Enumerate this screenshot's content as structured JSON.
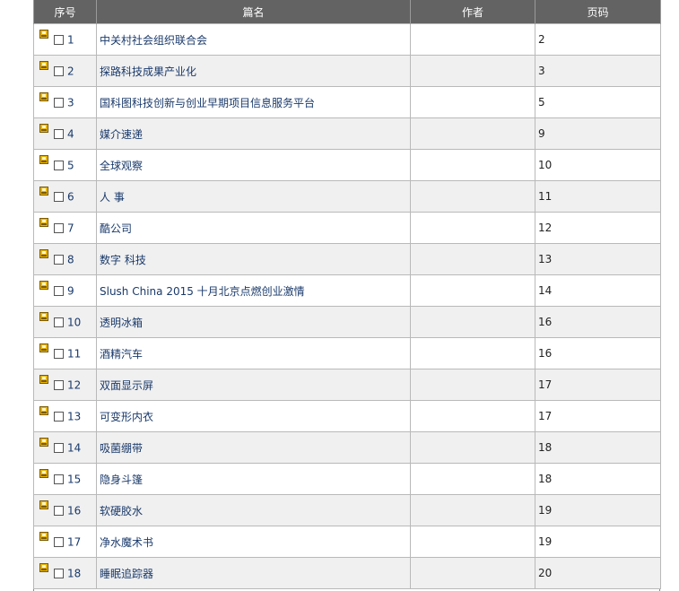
{
  "header": {
    "col_no": "序号",
    "col_title": "篇名",
    "col_author": "作者",
    "col_page": "页码"
  },
  "rows": [
    {
      "no": "1",
      "title": "中关村社会组织联合会",
      "author": "",
      "page": "2"
    },
    {
      "no": "2",
      "title": "探路科技成果产业化",
      "author": "",
      "page": "3"
    },
    {
      "no": "3",
      "title": "国科图科技创新与创业早期项目信息服务平台",
      "author": "",
      "page": "5"
    },
    {
      "no": "4",
      "title": "媒介速递",
      "author": "",
      "page": "9"
    },
    {
      "no": "5",
      "title": "全球观察",
      "author": "",
      "page": "10"
    },
    {
      "no": "6",
      "title": "人 事",
      "author": "",
      "page": "11"
    },
    {
      "no": "7",
      "title": "酷公司",
      "author": "",
      "page": "12"
    },
    {
      "no": "8",
      "title": "数字 科技",
      "author": "",
      "page": "13"
    },
    {
      "no": "9",
      "title": "Slush China 2015 十月北京点燃创业激情",
      "author": "",
      "page": "14"
    },
    {
      "no": "10",
      "title": "透明冰箱",
      "author": "",
      "page": "16"
    },
    {
      "no": "11",
      "title": "酒精汽车",
      "author": "",
      "page": "16"
    },
    {
      "no": "12",
      "title": "双面显示屏",
      "author": "",
      "page": "17"
    },
    {
      "no": "13",
      "title": "可变形内衣",
      "author": "",
      "page": "17"
    },
    {
      "no": "14",
      "title": "吸菌绷带",
      "author": "",
      "page": "18"
    },
    {
      "no": "15",
      "title": "隐身斗篷",
      "author": "",
      "page": "18"
    },
    {
      "no": "16",
      "title": "软硬胶水",
      "author": "",
      "page": "19"
    },
    {
      "no": "17",
      "title": "净水魔术书",
      "author": "",
      "page": "19"
    },
    {
      "no": "18",
      "title": "睡眠追踪器",
      "author": "",
      "page": "20"
    }
  ],
  "icons": {
    "row_icon": "save-disk-icon"
  },
  "colors": {
    "header_bg": "#636363",
    "link": "#1a3a6b",
    "row_alt": "#f0f0f0"
  }
}
